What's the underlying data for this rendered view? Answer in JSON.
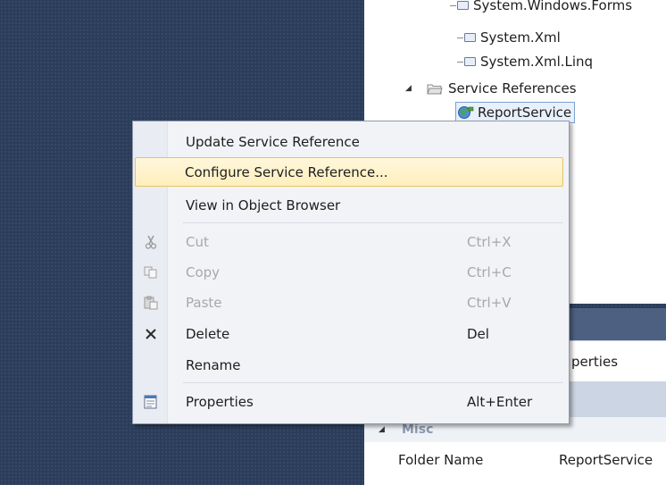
{
  "tree": {
    "items": [
      {
        "label": "System.Windows.Forms"
      },
      {
        "label": "System.Xml"
      },
      {
        "label": "System.Xml.Linq"
      },
      {
        "label": "Service References"
      },
      {
        "label": "ReportService"
      }
    ]
  },
  "context_menu": {
    "items": [
      {
        "label": "Update Service Reference",
        "shortcut": ""
      },
      {
        "label": "Configure Service Reference...",
        "shortcut": ""
      },
      {
        "label": "View in Object Browser",
        "shortcut": ""
      },
      {
        "label": "Cut",
        "shortcut": "Ctrl+X",
        "icon": "scissors-icon"
      },
      {
        "label": "Copy",
        "shortcut": "Ctrl+C",
        "icon": "copy-icon"
      },
      {
        "label": "Paste",
        "shortcut": "Ctrl+V",
        "icon": "paste-icon"
      },
      {
        "label": "Delete",
        "shortcut": "Del",
        "icon": "delete-icon"
      },
      {
        "label": "Rename",
        "shortcut": ""
      },
      {
        "label": "Properties",
        "shortcut": "Alt+Enter",
        "icon": "properties-icon"
      }
    ]
  },
  "properties": {
    "combo_text": "perties",
    "category": "Misc",
    "rows": [
      {
        "name": "Folder Name",
        "value": "ReportService"
      }
    ]
  },
  "colors": {
    "background": "#2c3d5a",
    "menu_highlight": "#ffefbc",
    "selection_border": "#7da2ce"
  }
}
